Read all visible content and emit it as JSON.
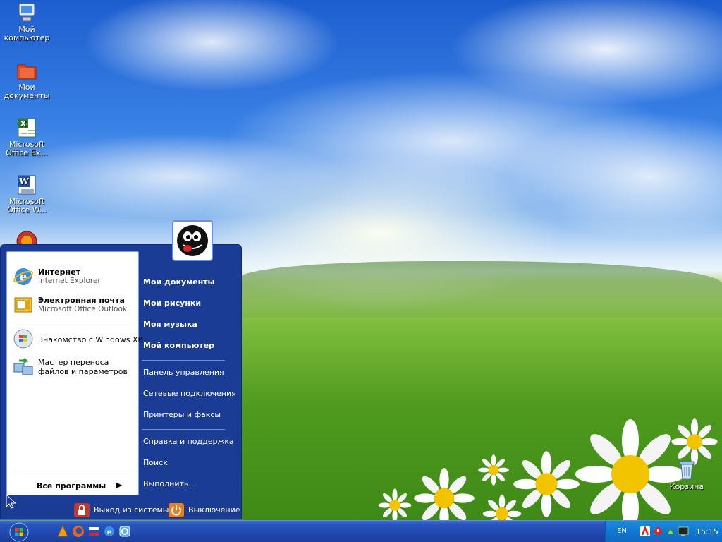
{
  "desktop_icons": [
    {
      "name": "my-computer",
      "label": "Мой компьютер",
      "icon": "computer-icon"
    },
    {
      "name": "my-documents",
      "label": "Мои документы",
      "icon": "folder-icon"
    },
    {
      "name": "excel",
      "label": "Microsoft Office Ex...",
      "icon": "excel-icon"
    },
    {
      "name": "word",
      "label": "Microsoft Office W...",
      "icon": "word-icon"
    },
    {
      "name": "recycle-bin",
      "label": "Корзина",
      "icon": "recycle-bin-icon"
    }
  ],
  "start_menu": {
    "pinned": [
      {
        "title": "Интернет",
        "subtitle": "Internet Explorer",
        "icon": "internet-explorer-icon"
      },
      {
        "title": "Электронная почта",
        "subtitle": "Microsoft Office Outlook",
        "icon": "outlook-icon"
      }
    ],
    "recent": [
      {
        "title": "Знакомство с Windows XP",
        "icon": "windows-tour-icon"
      },
      {
        "title": "Мастер переноса файлов и параметров",
        "icon": "transfer-wizard-icon"
      }
    ],
    "all_programs": "Все программы",
    "places": [
      "Мои документы",
      "Мои рисунки",
      "Моя музыка",
      "Мой компьютер"
    ],
    "settings": [
      "Панель управления",
      "Сетевые подключения",
      "Принтеры и факсы"
    ],
    "tools": [
      "Справка и поддержка",
      "Поиск",
      "Выполнить..."
    ],
    "logoff": "Выход из системы",
    "shutdown": "Выключение"
  },
  "taskbar": {
    "quick_launch": [
      "vlc-icon",
      "firefox-icon",
      "flag-icon",
      "internet-explorer-icon",
      "browser-icon"
    ],
    "language": "EN",
    "clock": "15:15"
  },
  "colors": {
    "start_menu_blue": "#1a3c94",
    "taskbar_blue": "#1f48b0",
    "tray_blue": "#1177d0"
  }
}
